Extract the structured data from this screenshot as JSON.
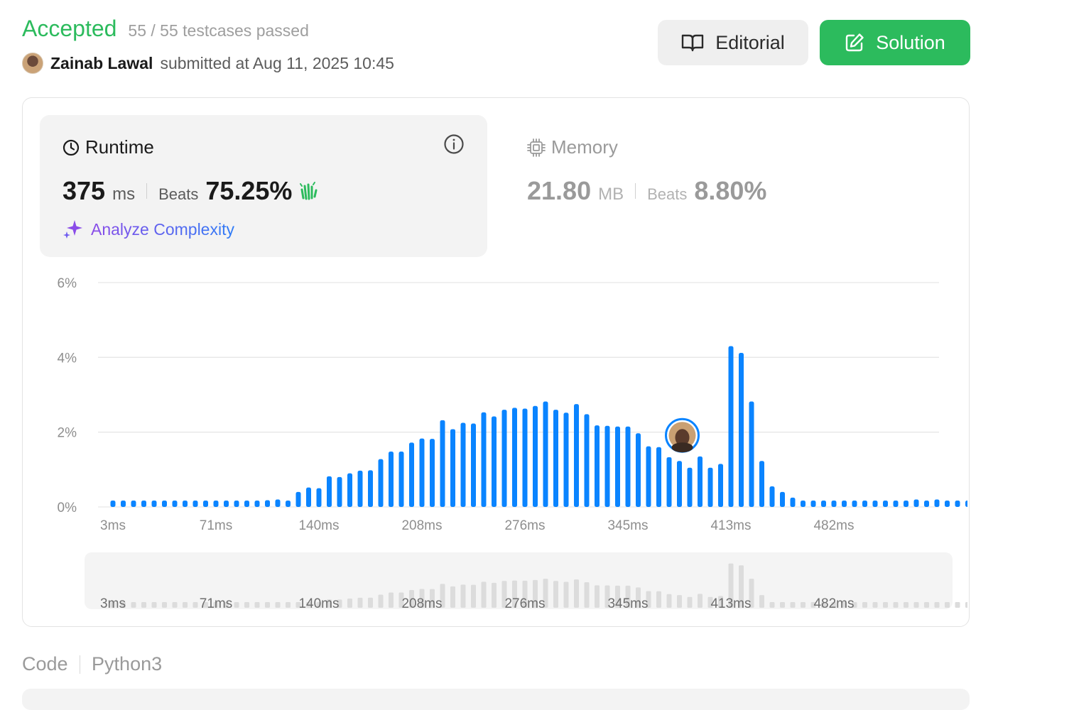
{
  "header": {
    "status": "Accepted",
    "testcases": "55 / 55 testcases passed",
    "username": "Zainab Lawal",
    "submitted_text": "submitted at Aug 11, 2025 10:45"
  },
  "buttons": {
    "editorial_label": "Editorial",
    "solution_label": "Solution"
  },
  "runtime": {
    "title": "Runtime",
    "value": "375",
    "unit": "ms",
    "beats_label": "Beats",
    "beats_value": "75.25%",
    "analyze_label": "Analyze Complexity"
  },
  "memory": {
    "title": "Memory",
    "value": "21.80",
    "unit": "MB",
    "beats_label": "Beats",
    "beats_value": "8.80%"
  },
  "code": {
    "label": "Code",
    "language": "Python3"
  },
  "colors": {
    "accepted": "#2cbb5d",
    "bar": "#0a84ff",
    "analyze_gradient_start": "#8a4be8",
    "analyze_gradient_end": "#2f7cf6"
  },
  "chart_data": {
    "type": "bar",
    "xlabel": "",
    "ylabel": "",
    "y_ticks": [
      "0%",
      "2%",
      "4%",
      "6%"
    ],
    "ylim": [
      0,
      6
    ],
    "x_ticks": [
      "3ms",
      "71ms",
      "140ms",
      "208ms",
      "276ms",
      "345ms",
      "413ms",
      "482ms"
    ],
    "grid": true,
    "highlight_bar_index": 55,
    "values": [
      0.17,
      0.17,
      0.17,
      0.17,
      0.17,
      0.17,
      0.17,
      0.17,
      0.17,
      0.17,
      0.17,
      0.17,
      0.17,
      0.17,
      0.17,
      0.18,
      0.2,
      0.17,
      0.4,
      0.52,
      0.5,
      0.82,
      0.8,
      0.9,
      0.97,
      0.98,
      1.28,
      1.48,
      1.48,
      1.72,
      1.83,
      1.82,
      2.32,
      2.08,
      2.25,
      2.23,
      2.53,
      2.42,
      2.6,
      2.65,
      2.63,
      2.7,
      2.82,
      2.6,
      2.52,
      2.75,
      2.48,
      2.18,
      2.17,
      2.15,
      2.15,
      1.97,
      1.62,
      1.6,
      1.33,
      1.23,
      1.05,
      1.35,
      1.05,
      1.15,
      4.3,
      4.12,
      2.82,
      1.23,
      0.55,
      0.4,
      0.25,
      0.17,
      0.17,
      0.17,
      0.17,
      0.17,
      0.17,
      0.17,
      0.17,
      0.17,
      0.17,
      0.17,
      0.2,
      0.17,
      0.2,
      0.17,
      0.17,
      0.17
    ]
  }
}
